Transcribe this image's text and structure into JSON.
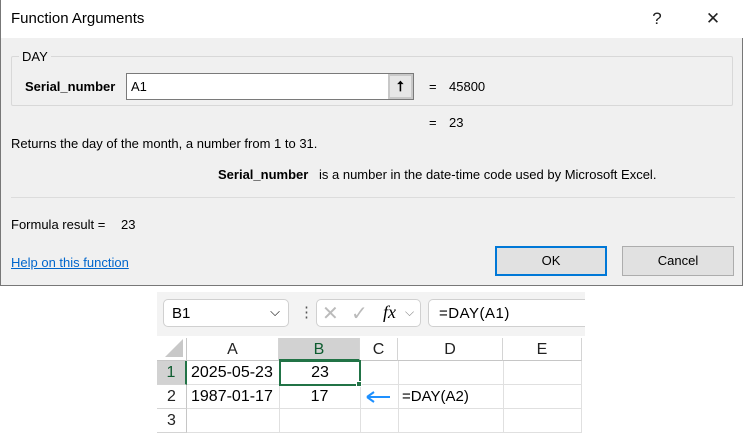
{
  "dialog": {
    "title": "Function Arguments",
    "help_glyph": "?",
    "close_glyph": "✕",
    "function_name": "DAY",
    "arg_label": "Serial_number",
    "arg_value": "A1",
    "arg_eq": "=",
    "arg_result": "45800",
    "result_eq": "=",
    "result": "23",
    "description": "Returns the day of the month, a number from 1 to 31.",
    "arg_desc_name": "Serial_number",
    "arg_desc": "is a number in the date-time code used by Microsoft Excel.",
    "formula_result_label": "Formula result =",
    "formula_result": "23",
    "help_link": "Help on this function",
    "ok": "OK",
    "cancel": "Cancel"
  },
  "sheet": {
    "name_box": "B1",
    "fx": "fx",
    "formula": "=DAY(A1)",
    "columns": [
      "A",
      "B",
      "C",
      "D",
      "E"
    ],
    "rows": [
      "1",
      "2",
      "3"
    ],
    "cells": {
      "A1": "2025-05-23",
      "B1": "23",
      "A2": "1987-01-17",
      "B2": "17",
      "D2": "=DAY(A2)"
    },
    "arrow_color": "#1e90ff",
    "selection_color": "#217346"
  }
}
